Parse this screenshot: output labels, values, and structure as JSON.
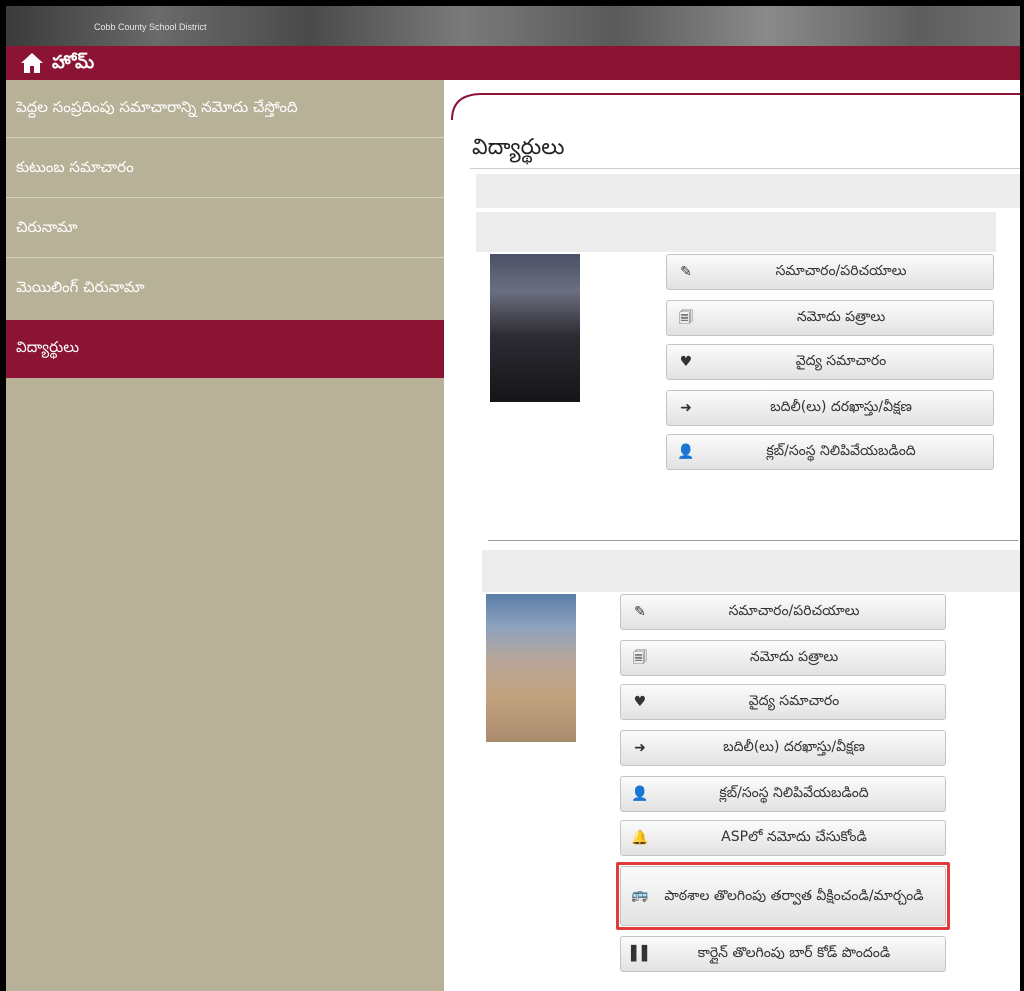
{
  "banner": {
    "district": "Cobb County School District"
  },
  "homebar": {
    "label": "హోమ్",
    "icon": "home-icon"
  },
  "sidebar": {
    "items": [
      {
        "label": "పెద్దల సంప్రదింపు సమాచారాన్ని నమోదు చేస్తోంది",
        "active": false
      },
      {
        "label": "కుటుంబ సమాచారం",
        "active": false
      },
      {
        "label": "చిరునామా",
        "active": false
      },
      {
        "label": "మెయిలింగ్ చిరునామా",
        "active": false
      },
      {
        "label": "విద్యార్థులు",
        "active": true
      }
    ]
  },
  "main": {
    "title": "విద్యార్థులు",
    "students": [
      {
        "buttons": [
          {
            "icon": "pencil-icon",
            "label": "సమాచారం/పరిచయాలు"
          },
          {
            "icon": "documents-icon",
            "label": "నమోదు పత్రాలు"
          },
          {
            "icon": "heartbeat-icon",
            "label": "వైద్య సమాచారం"
          },
          {
            "icon": "arrow-icon",
            "label": "బదిలీ(లు) దరఖాస్తు/వీక్షణ"
          },
          {
            "icon": "user-icon",
            "label": "క్లబ్/సంస్థ నిలిపివేయబడింది"
          }
        ]
      },
      {
        "buttons": [
          {
            "icon": "pencil-icon",
            "label": "సమాచారం/పరిచయాలు"
          },
          {
            "icon": "documents-icon",
            "label": "నమోదు పత్రాలు"
          },
          {
            "icon": "heartbeat-icon",
            "label": "వైద్య సమాచారం"
          },
          {
            "icon": "arrow-icon",
            "label": "బదిలీ(లు) దరఖాస్తు/వీక్షణ"
          },
          {
            "icon": "user-icon",
            "label": "క్లబ్/సంస్థ నిలిపివేయబడింది"
          },
          {
            "icon": "bell-icon",
            "label": "ASPలో నమోదు చేసుకోండి"
          },
          {
            "icon": "bus-icon",
            "label": "పాఠశాల తొలగింపు తర్వాత వీక్షించండి/మార్చండి"
          },
          {
            "icon": "barcode-icon",
            "label": "కార్లైన్ తొలగింపు బార్ కోడ్ పొందండి"
          }
        ]
      }
    ]
  },
  "colors": {
    "maroon": "#8b1434",
    "sidebar": "#b7b198",
    "highlight": "#e23b3b"
  }
}
